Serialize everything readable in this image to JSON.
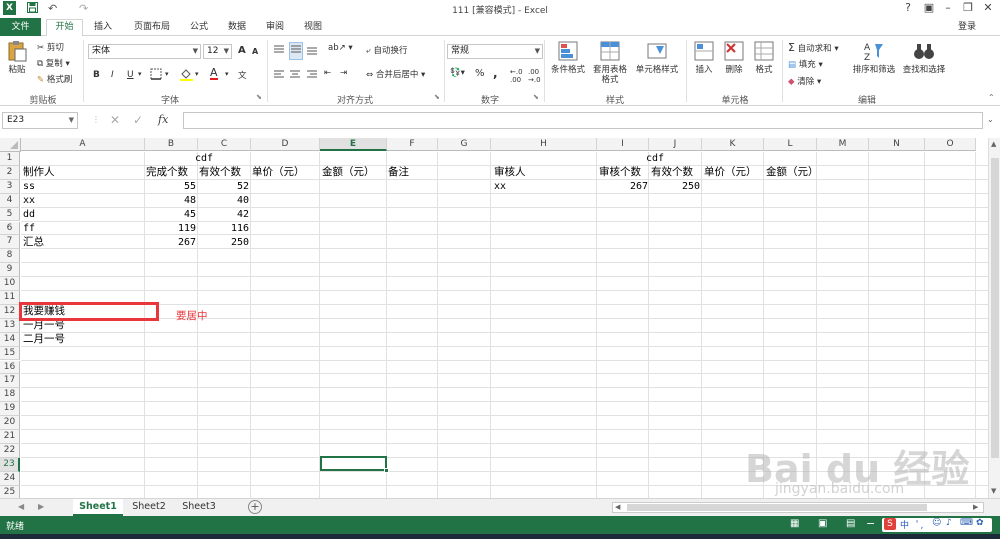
{
  "window": {
    "title": "111 [兼容模式] - Excel",
    "help": "?",
    "minimize": "–",
    "restore": "❐",
    "close": "✕",
    "login": "登录"
  },
  "quick_access": {
    "logo": "X",
    "save": "💾",
    "undo": "↶",
    "redo": "↷"
  },
  "tabs": [
    "文件",
    "开始",
    "插入",
    "页面布局",
    "公式",
    "数据",
    "审阅",
    "视图"
  ],
  "ribbon": {
    "clipboard": {
      "paste": "粘贴",
      "cut": "剪切",
      "copy": "复制",
      "format_painter": "格式刷",
      "label": "剪贴板"
    },
    "font": {
      "name": "宋体",
      "size": "12",
      "grow": "A",
      "shrink": "A",
      "bold": "B",
      "italic": "I",
      "underline": "U",
      "label": "字体"
    },
    "alignment": {
      "wrap": "自动换行",
      "merge": "合并后居中",
      "label": "对齐方式"
    },
    "number": {
      "format": "常规",
      "percent": "%",
      "comma": ",",
      "label": "数字"
    },
    "styles": {
      "conditional": "条件格式",
      "table": "套用表格格式",
      "cell_styles": "单元格样式",
      "label": "样式"
    },
    "cells": {
      "insert": "插入",
      "delete": "删除",
      "format": "格式",
      "label": "单元格"
    },
    "editing": {
      "autosum": "自动求和",
      "fill": "填充",
      "clear": "清除",
      "sort": "排序和筛选",
      "find": "查找和选择",
      "label": "编辑"
    }
  },
  "formula_bar": {
    "name_box": "E23",
    "fx": "fx",
    "cancel": "✕",
    "enter": "✓",
    "value": ""
  },
  "sheet": {
    "columns": [
      "A",
      "B",
      "C",
      "D",
      "E",
      "F",
      "G",
      "H",
      "I",
      "J",
      "K",
      "L",
      "M",
      "N",
      "O"
    ],
    "selected_column": "E",
    "rows": [
      "1",
      "2",
      "3",
      "4",
      "5",
      "6",
      "7",
      "8",
      "9",
      "10",
      "11",
      "12",
      "13",
      "14",
      "15",
      "16",
      "17",
      "18",
      "19",
      "20",
      "21",
      "22",
      "23",
      "24",
      "25"
    ],
    "selected_row": "23",
    "header_left": "cdf",
    "header_right": "cdf",
    "left_table": {
      "headers": [
        "制作人",
        "完成个数",
        "有效个数",
        "单价（元）",
        "金额（元）",
        "备注"
      ],
      "rows": [
        [
          "ss",
          "55",
          "52"
        ],
        [
          "xx",
          "48",
          "40"
        ],
        [
          "dd",
          "45",
          "42"
        ],
        [
          "ff",
          "119",
          "116"
        ],
        [
          "汇总",
          "267",
          "250"
        ]
      ]
    },
    "right_table": {
      "headers": [
        "审核人",
        "审核个数",
        "有效个数",
        "单价（元）",
        "金额（元）"
      ],
      "rows": [
        [
          "xx",
          "267",
          "250"
        ]
      ]
    },
    "a12": "我要赚钱",
    "a13": "一月一号",
    "a14": "二月一号",
    "annotation": "要居中"
  },
  "sheet_tabs": [
    "Sheet1",
    "Sheet2",
    "Sheet3"
  ],
  "active_sheet": "Sheet1",
  "add_sheet": "+",
  "status": {
    "ready": "就绪",
    "zoom_minus": "−",
    "zoom_plus": "+"
  },
  "watermark": {
    "brand": "Bai du 经验",
    "url": "jingyan.baidu.com"
  },
  "colors": {
    "excel_green": "#217346",
    "highlight_red": "#e8363a",
    "annotation_red": "#e8363a"
  }
}
